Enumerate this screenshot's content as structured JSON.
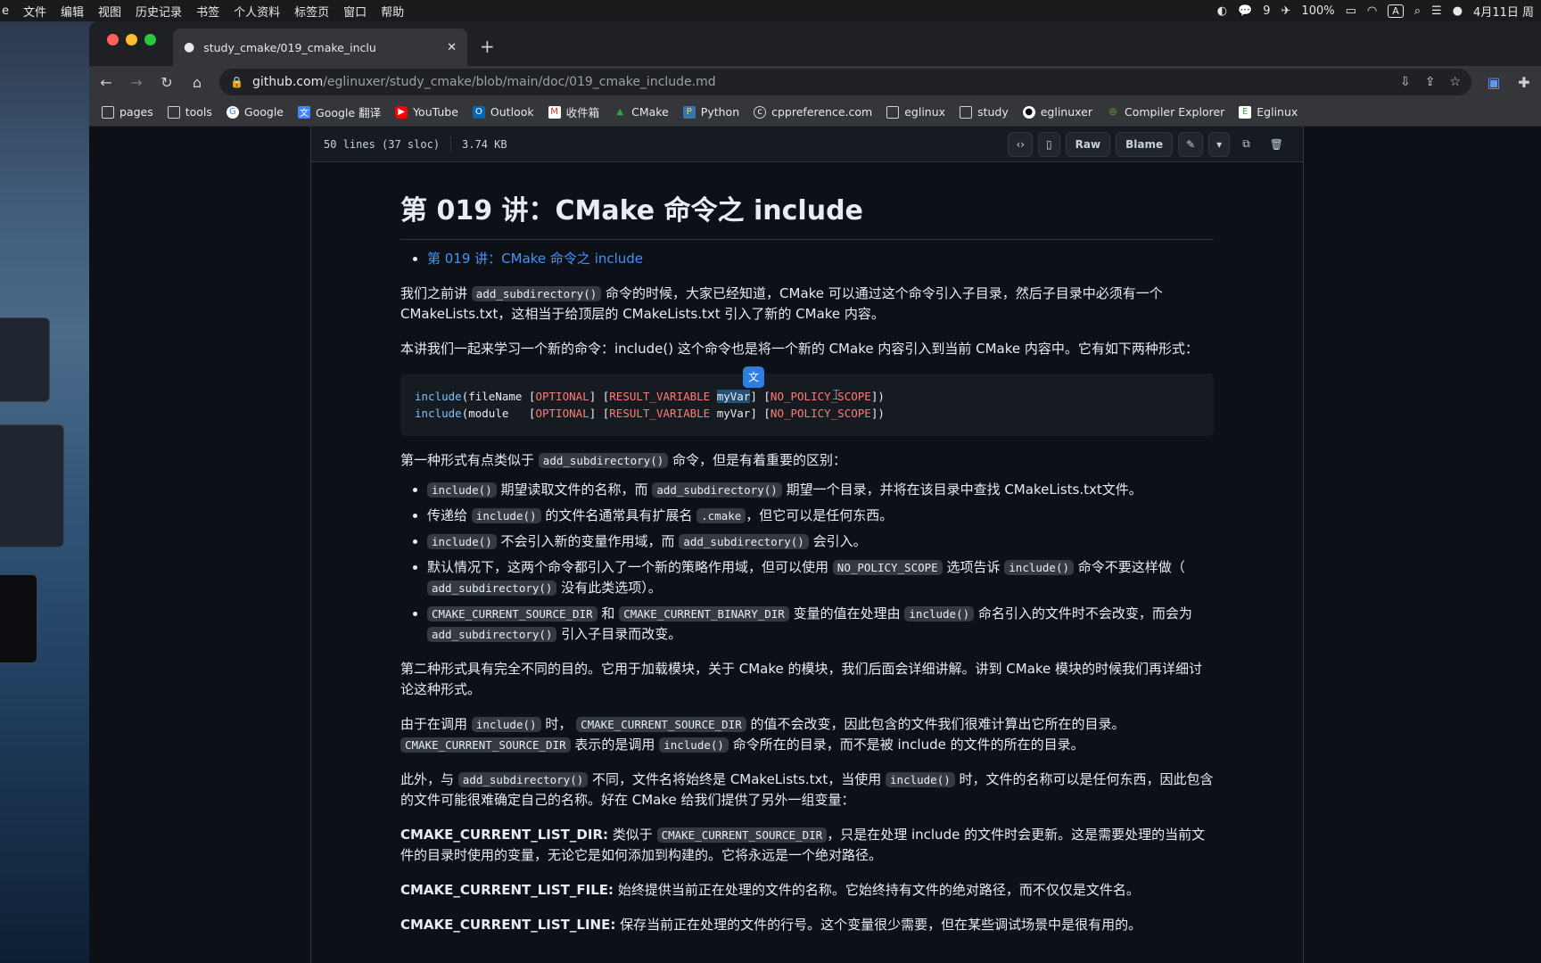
{
  "menubar": {
    "items": [
      "文件",
      "编辑",
      "视图",
      "历史记录",
      "书签",
      "个人资料",
      "标签页",
      "窗口",
      "帮助"
    ],
    "wechat_count": "9",
    "battery": "100%",
    "input_method": "A",
    "date": "4月11日 周"
  },
  "tab": {
    "title": "study_cmake/019_cmake_inclu"
  },
  "omnibox": {
    "host": "github.com",
    "path": "/eglinuxer/study_cmake/blob/main/doc/019_cmake_include.md"
  },
  "bookmarks": [
    {
      "label": "pages",
      "icon": "folder-icon"
    },
    {
      "label": "tools",
      "icon": "folder-icon"
    },
    {
      "label": "Google",
      "icon": "google-icon"
    },
    {
      "label": "Google 翻译",
      "icon": "translate-icon"
    },
    {
      "label": "YouTube",
      "icon": "youtube-icon"
    },
    {
      "label": "Outlook",
      "icon": "outlook-icon"
    },
    {
      "label": "收件箱",
      "icon": "gmail-icon"
    },
    {
      "label": "CMake",
      "icon": "cmake-icon"
    },
    {
      "label": "Python",
      "icon": "python-icon"
    },
    {
      "label": "cppreference.com",
      "icon": "cppreference-icon"
    },
    {
      "label": "eglinux",
      "icon": "folder-icon"
    },
    {
      "label": "study",
      "icon": "folder-icon"
    },
    {
      "label": "eglinuxer",
      "icon": "github-icon"
    },
    {
      "label": "Compiler Explorer",
      "icon": "compiler-explorer-icon"
    },
    {
      "label": "Eglinux",
      "icon": "eglinux-icon"
    }
  ],
  "file_header": {
    "lines": "50 lines (37 sloc)",
    "size": "3.74 KB",
    "raw": "Raw",
    "blame": "Blame"
  },
  "doc": {
    "title": "第 019 讲：CMake 命令之 include",
    "toc_link": "第 019 讲：CMake 命令之 include",
    "p1": {
      "a": "我们之前讲",
      "code": "add_subdirectory()",
      "b": "命令的时候，大家已经知道，CMake 可以通过这个命令引入子目录，然后子目录中必须有一个 CMakeLists.txt，这相当于给顶层的 CMakeLists.txt 引入了新的 CMake 内容。"
    },
    "p2": "本讲我们一起来学习一个新的命令：include() 这个命令也是将一个新的 CMake 内容引入到当前 CMake 内容中。它有如下两种形式：",
    "code_block": [
      {
        "fn": "include",
        "arg": "(fileName ",
        "opt": "OPTIONAL",
        "rv": "RESULT_VARIABLE",
        "var": "myVar",
        "nps": "NO_POLICY_SCOPE"
      },
      {
        "fn": "include",
        "arg": "(module   ",
        "opt": "OPTIONAL",
        "rv": "RESULT_VARIABLE",
        "var": "myVar",
        "nps": "NO_POLICY_SCOPE"
      }
    ],
    "p3": {
      "a": "第一种形式有点类似于",
      "code": "add_subdirectory()",
      "b": "命令，但是有着重要的区别："
    },
    "list": [
      {
        "c1": "include()",
        "t1": "期望读取文件的名称，而",
        "c2": "add_subdirectory()",
        "t2": "期望一个目录，并将在该目录中查找 CMakeLists.txt文件。"
      },
      {
        "t0": "传递给",
        "c1": "include()",
        "t1": "的文件名通常具有扩展名",
        "c2": ".cmake",
        "t2": "，但它可以是任何东西。"
      },
      {
        "c1": "include()",
        "t1": "不会引入新的变量作用域，而",
        "c2": "add_subdirectory()",
        "t2": "会引入。"
      },
      {
        "t0": "默认情况下，这两个命令都引入了一个新的策略作用域，但可以使用",
        "c1": "NO_POLICY_SCOPE",
        "t1": "选项告诉",
        "c2": "include()",
        "t2": "命令不要这样做（",
        "c3": "add_subdirectory()",
        "t3": "没有此类选项）。"
      },
      {
        "c1": "CMAKE_CURRENT_SOURCE_DIR",
        "t1": "和",
        "c2": "CMAKE_CURRENT_BINARY_DIR",
        "t2": "变量的值在处理由",
        "c3": "include()",
        "t3": "命名引入的文件时不会改变，而会为",
        "c4": "add_subdirectory()",
        "t4": "引入子目录而改变。"
      }
    ],
    "p4": "第二种形式具有完全不同的目的。它用于加载模块，关于 CMake 的模块，我们后面会详细讲解。讲到 CMake 模块的时候我们再详细讨论这种形式。",
    "p5": {
      "a": "由于在调用",
      "c1": "include()",
      "b": "时，",
      "c2": "CMAKE_CURRENT_SOURCE_DIR",
      "c": "的值不会改变，因此包含的文件我们很难计算出它所在的目录。",
      "c3": "CMAKE_CURRENT_SOURCE_DIR",
      "d": "表示的是调用",
      "c4": "include()",
      "e": "命令所在的目录，而不是被 include 的文件的所在的目录。"
    },
    "p6": {
      "a": "此外，与",
      "c1": "add_subdirectory()",
      "b": "不同，文件名将始终是 CMakeLists.txt，当使用",
      "c2": "include()",
      "c": "时，文件的名称可以是任何东西，因此包含的文件可能很难确定自己的名称。好在 CMake 给我们提供了另外一组变量："
    },
    "p7": {
      "b": "CMAKE_CURRENT_LIST_DIR:",
      "a": "类似于",
      "c1": "CMAKE_CURRENT_SOURCE_DIR",
      "c": "，只是在处理 include 的文件时会更新。这是需要处理的当前文件的目录时使用的变量，无论它是如何添加到构建的。它将永远是一个绝对路径。"
    },
    "p8": {
      "b": "CMAKE_CURRENT_LIST_FILE:",
      "a": "始终提供当前正在处理的文件的名称。它始终持有文件的绝对路径，而不仅仅是文件名。"
    },
    "p9": {
      "b": "CMAKE_CURRENT_LIST_LINE:",
      "a": "保存当前正在处理的文件的行号。这个变量很少需要，但在某些调试场景中是很有用的。"
    }
  }
}
